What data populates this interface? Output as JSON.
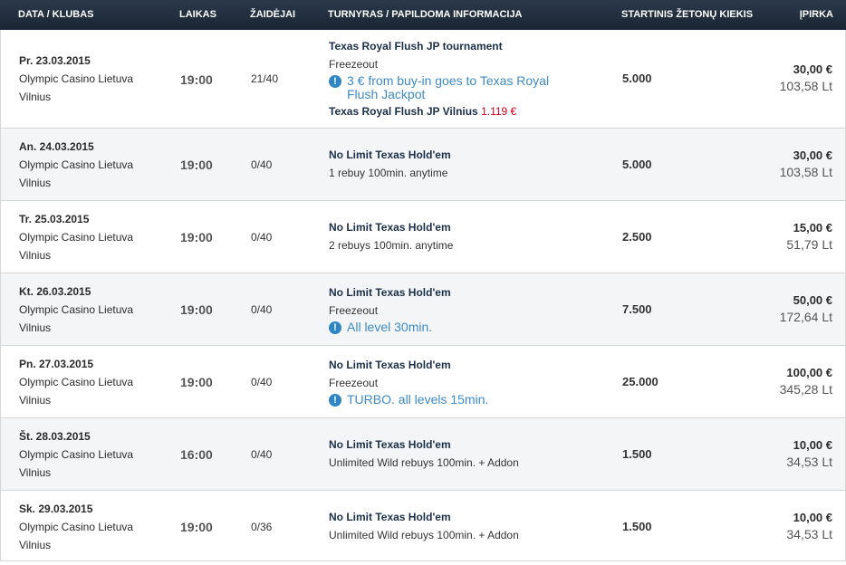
{
  "header": {
    "date_club": "DATA / KLUBAS",
    "time": "LAIKAS",
    "players": "ŽAIDĖJAI",
    "tournament": "TURNYRAS / PAPILDOMA INFORMACIJA",
    "chips": "STARTINIS ŽETONŲ KIEKIS",
    "price": "ĮPIRKA"
  },
  "rows": [
    {
      "date": "Pr. 23.03.2015",
      "club": "Olympic Casino Lietuva",
      "city": "Vilnius",
      "time": "19:00",
      "players": "21/40",
      "name": "Texas Royal Flush JP tournament",
      "detail": "Freezeout",
      "info": "3 € from buy-in goes to Texas Royal Flush Jackpot",
      "jackpot_label": "Texas Royal Flush JP Vilnius",
      "jackpot_amount": "1.119 €",
      "chips": "5.000",
      "eur": "30,00 €",
      "lt": "103,58 Lt"
    },
    {
      "date": "An. 24.03.2015",
      "club": "Olympic Casino Lietuva",
      "city": "Vilnius",
      "time": "19:00",
      "players": "0/40",
      "name": "No Limit Texas Hold'em",
      "detail": "1 rebuy 100min. anytime",
      "chips": "5.000",
      "eur": "30,00 €",
      "lt": "103,58 Lt"
    },
    {
      "date": "Tr. 25.03.2015",
      "club": "Olympic Casino Lietuva",
      "city": "Vilnius",
      "time": "19:00",
      "players": "0/40",
      "name": "No Limit Texas Hold'em",
      "detail": "2 rebuys 100min. anytime",
      "chips": "2.500",
      "eur": "15,00 €",
      "lt": "51,79 Lt"
    },
    {
      "date": "Kt. 26.03.2015",
      "club": "Olympic Casino Lietuva",
      "city": "Vilnius",
      "time": "19:00",
      "players": "0/40",
      "name": "No Limit Texas Hold'em",
      "detail": "Freezeout",
      "info": "All level 30min.",
      "chips": "7.500",
      "eur": "50,00 €",
      "lt": "172,64 Lt"
    },
    {
      "date": "Pn. 27.03.2015",
      "club": "Olympic Casino Lietuva",
      "city": "Vilnius",
      "time": "19:00",
      "players": "0/40",
      "name": "No Limit Texas Hold'em",
      "detail": "Freezeout",
      "info": "TURBO. all levels 15min.",
      "chips": "25.000",
      "eur": "100,00 €",
      "lt": "345,28 Lt"
    },
    {
      "date": "Št. 28.03.2015",
      "club": "Olympic Casino Lietuva",
      "city": "Vilnius",
      "time": "16:00",
      "players": "0/40",
      "name": "No Limit Texas Hold'em",
      "detail": "Unlimited Wild rebuys 100min. + Addon",
      "chips": "1.500",
      "eur": "10,00 €",
      "lt": "34,53 Lt"
    },
    {
      "date": "Sk. 29.03.2015",
      "club": "Olympic Casino Lietuva",
      "city": "Vilnius",
      "time": "19:00",
      "players": "0/36",
      "name": "No Limit Texas Hold'em",
      "detail": "Unlimited Wild rebuys 100min. + Addon",
      "chips": "1.500",
      "eur": "10,00 €",
      "lt": "34,53 Lt"
    }
  ],
  "colors": {
    "header_bg": "#1f2b3a",
    "info": "#3d8ac6",
    "jackpot": "#d0021b"
  },
  "icons": {
    "info": "exclamation-circle-icon"
  }
}
